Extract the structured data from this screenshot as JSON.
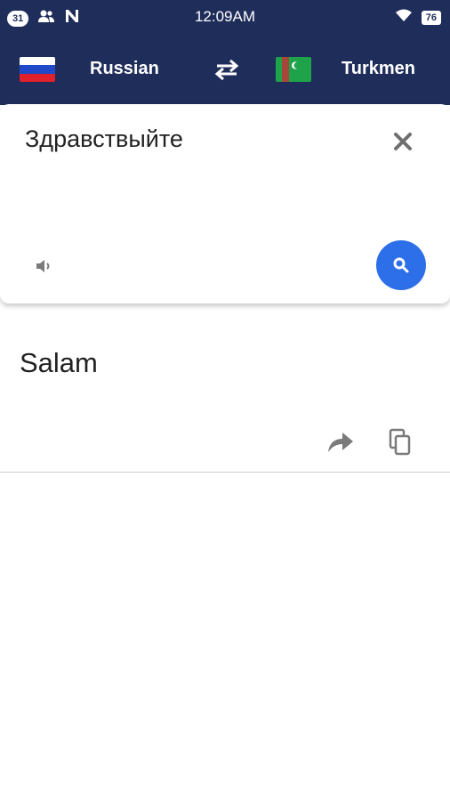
{
  "status_bar": {
    "notification_count": "31",
    "time": "12:09AM",
    "battery": "76",
    "icons": [
      "notification-badge",
      "contacts-icon",
      "n-app-icon",
      "wifi-icon",
      "battery-icon"
    ]
  },
  "toolbar": {
    "source_language": "Russian",
    "target_language": "Turkmen",
    "source_flag": "russia-flag",
    "target_flag": "turkmenistan-flag",
    "swap_icon": "swap-arrows-icon"
  },
  "input_card": {
    "text": "Здравствыйте",
    "clear_icon": "close-icon",
    "speaker_icon": "speaker-icon",
    "search_icon": "search-icon"
  },
  "result": {
    "text": "Salam",
    "share_icon": "share-icon",
    "copy_icon": "copy-icon"
  },
  "colors": {
    "header_bg": "#1f2d5a",
    "accent_blue": "#2c6fe8",
    "icon_gray": "#7a7a7a"
  }
}
